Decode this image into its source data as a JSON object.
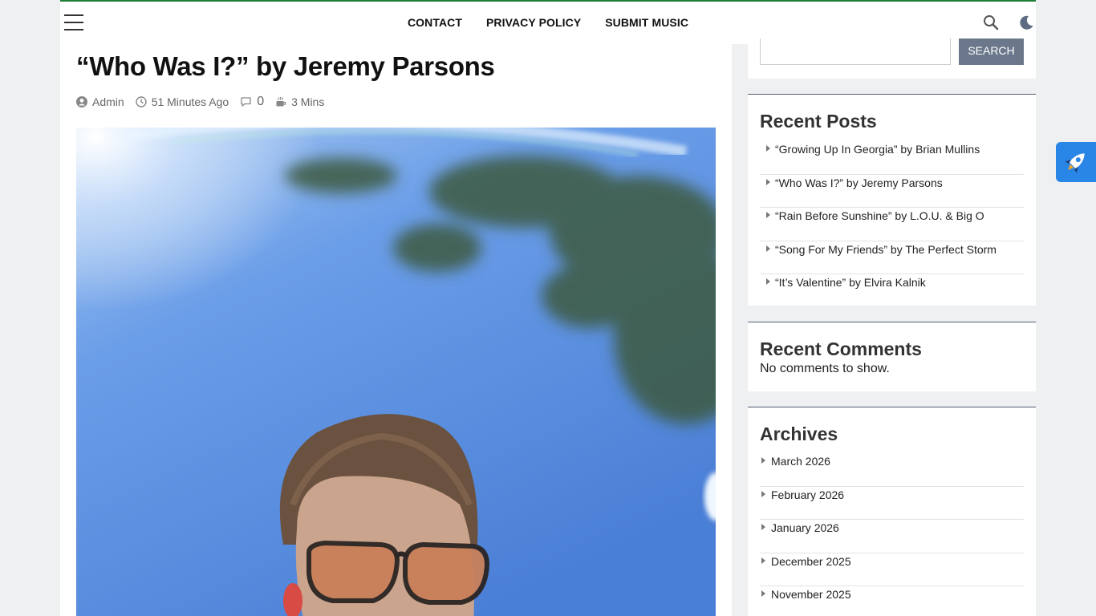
{
  "header": {
    "nav": [
      "CONTACT",
      "PRIVACY POLICY",
      "SUBMIT MUSIC"
    ],
    "icons": {
      "menu": "hamburger-icon",
      "search": "search-icon",
      "theme": "moon-icon"
    }
  },
  "article": {
    "title": "“Who Was I?” by Jeremy Parsons",
    "meta": {
      "author": "Admin",
      "time": "51 Minutes Ago",
      "comments": "0",
      "read_time": "3 Mins"
    }
  },
  "sidebar": {
    "search": {
      "button": "SEARCH",
      "placeholder": ""
    },
    "recent_posts": {
      "title": "Recent Posts",
      "items": [
        "“Growing Up In Georgia” by Brian Mullins",
        "“Who Was I?” by Jeremy Parsons",
        "“Rain Before Sunshine” by L.O.U. & Big O",
        "“Song For My Friends” by The Perfect Storm",
        "“It’s Valentine” by Elvira Kalnik"
      ]
    },
    "recent_comments": {
      "title": "Recent Comments",
      "text": "No comments to show."
    },
    "archives": {
      "title": "Archives",
      "items": [
        "March 2026",
        "February 2026",
        "January 2026",
        "December 2025",
        "November 2025"
      ]
    }
  },
  "colors": {
    "accent_top": "#1e7e34",
    "search_button": "#6b788c",
    "rocket_button": "#2a86e6"
  }
}
